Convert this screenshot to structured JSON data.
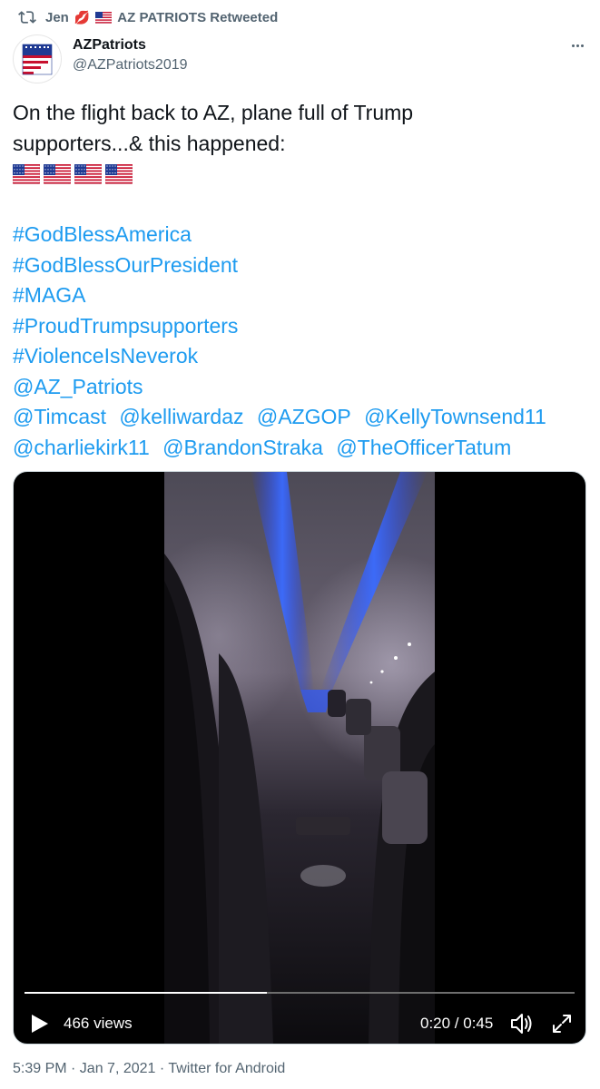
{
  "retweet": {
    "icon": "retweet-icon",
    "user": "Jen",
    "emoji": "💋",
    "suffix": "AZ PATRIOTS Retweeted"
  },
  "author": {
    "display_name": "AZPatriots",
    "handle": "@AZPatriots2019",
    "avatar_text": "AZ PATRIOTS"
  },
  "tweet": {
    "line1": "On the flight back to AZ, plane full of Trump",
    "line2": "supporters...& this happened:",
    "flag_count": 4,
    "links": [
      "#GodBlessAmerica",
      "#GodBlessOurPresident",
      "#MAGA",
      "#ProudTrumpsupporters",
      "#ViolenceIsNeverok",
      "@AZ_Patriots"
    ],
    "mentions_row1": [
      "@Timcast",
      "@kelliwardaz",
      "@AZGOP",
      "@KellyTownsend11"
    ],
    "mentions_row2": [
      "@charliekirk11",
      "@BrandonStraka",
      "@TheOfficerTatum"
    ]
  },
  "video": {
    "views": "466 views",
    "time": "0:20 / 0:45",
    "progress": 0.44
  },
  "footer": {
    "text": "5:39 PM · Jan 7, 2021 · Twitter for Android"
  },
  "colors": {
    "link": "#1d9bf0",
    "secondary_text": "#536471"
  }
}
